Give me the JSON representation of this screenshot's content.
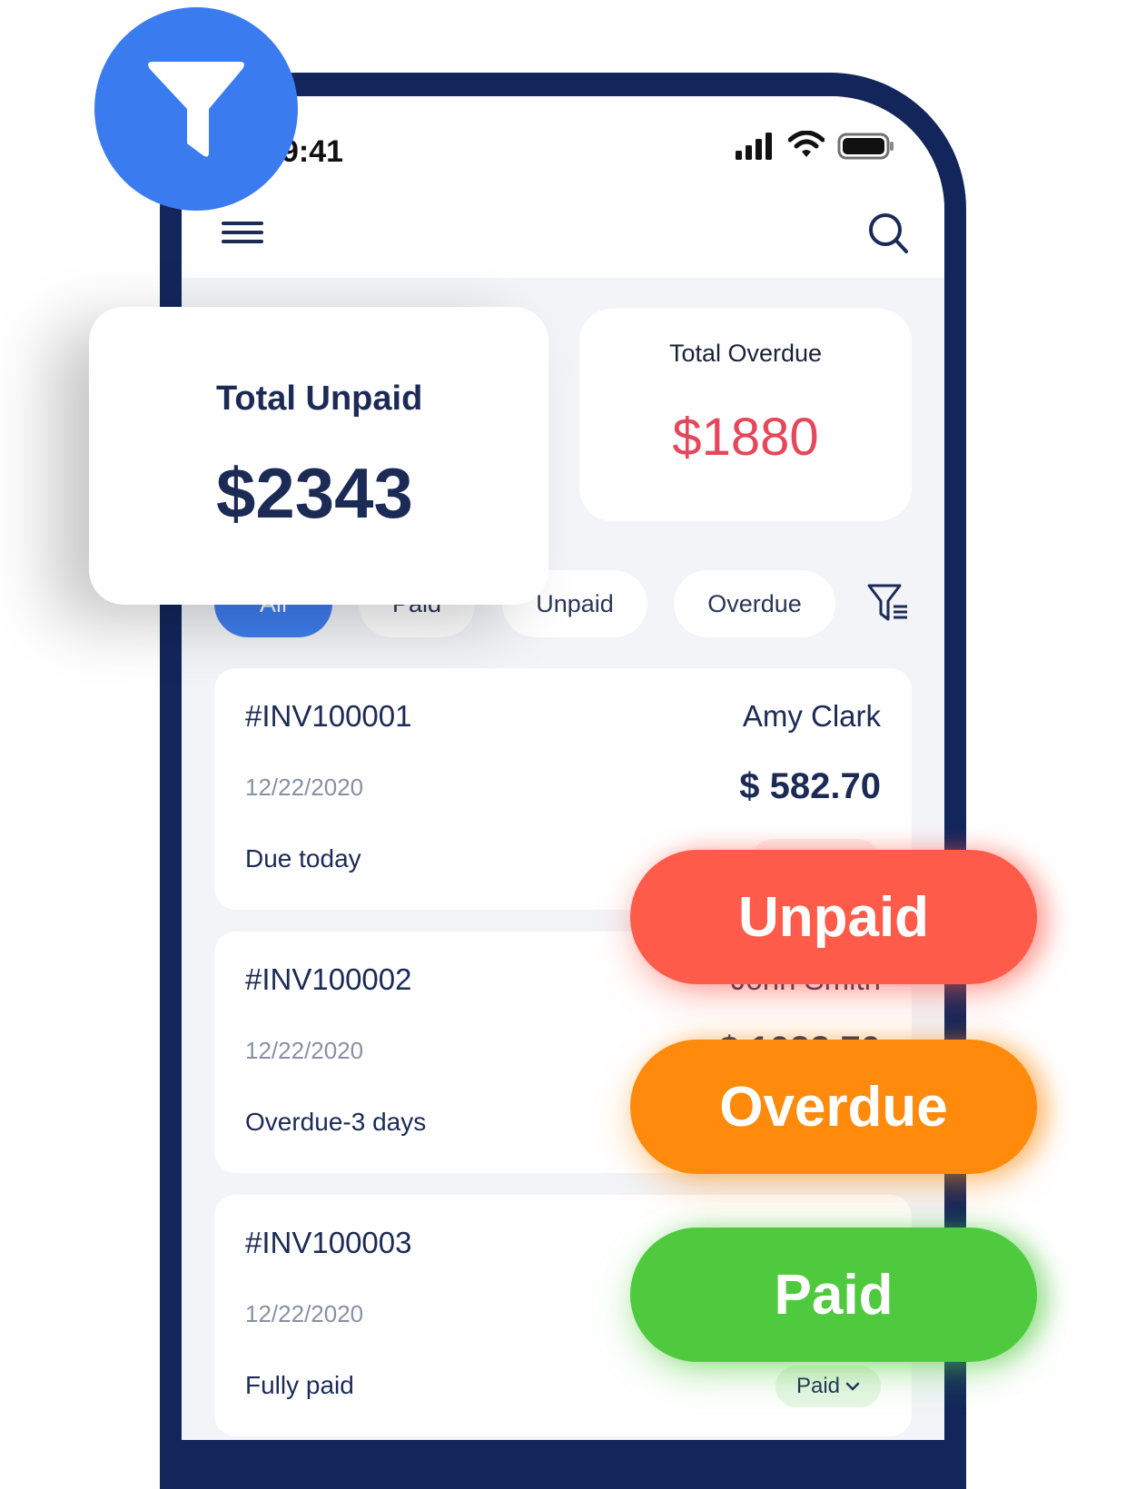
{
  "status_bar": {
    "time": "9:41"
  },
  "summary": {
    "total_unpaid_label": "Total Unpaid",
    "total_unpaid_value": "$2343",
    "total_overdue_label": "Total Overdue",
    "total_overdue_value": "$1880"
  },
  "filters": [
    "All",
    "Paid",
    "Unpaid",
    "Overdue"
  ],
  "invoices": [
    {
      "number": "#INV100001",
      "date": "12/22/2020",
      "status": "Due today",
      "customer": "Amy Clark",
      "amount": "$ 582.70"
    },
    {
      "number": "#INV100002",
      "date": "12/22/2020",
      "status": "Overdue-3 days",
      "customer": "John Smith",
      "amount": "$ 1022.70"
    },
    {
      "number": "#INV100003",
      "date": "12/22/2020",
      "status": "Fully paid",
      "badge": "Paid"
    }
  ],
  "status_pills": {
    "unpaid": "Unpaid",
    "overdue": "Overdue",
    "paid": "Paid"
  },
  "colors": {
    "primary": "#3b7bf0",
    "navy": "#1c2a56",
    "overdue_text": "#e5475b",
    "unpaid_pill": "#fe5b4a",
    "overdue_pill": "#ff8a0c",
    "paid_pill": "#4fc93d"
  },
  "icons": [
    "filter-icon",
    "menu-icon",
    "search-icon",
    "filter-list-icon",
    "signal-icon",
    "wifi-icon",
    "battery-icon",
    "chevron-down-icon"
  ]
}
